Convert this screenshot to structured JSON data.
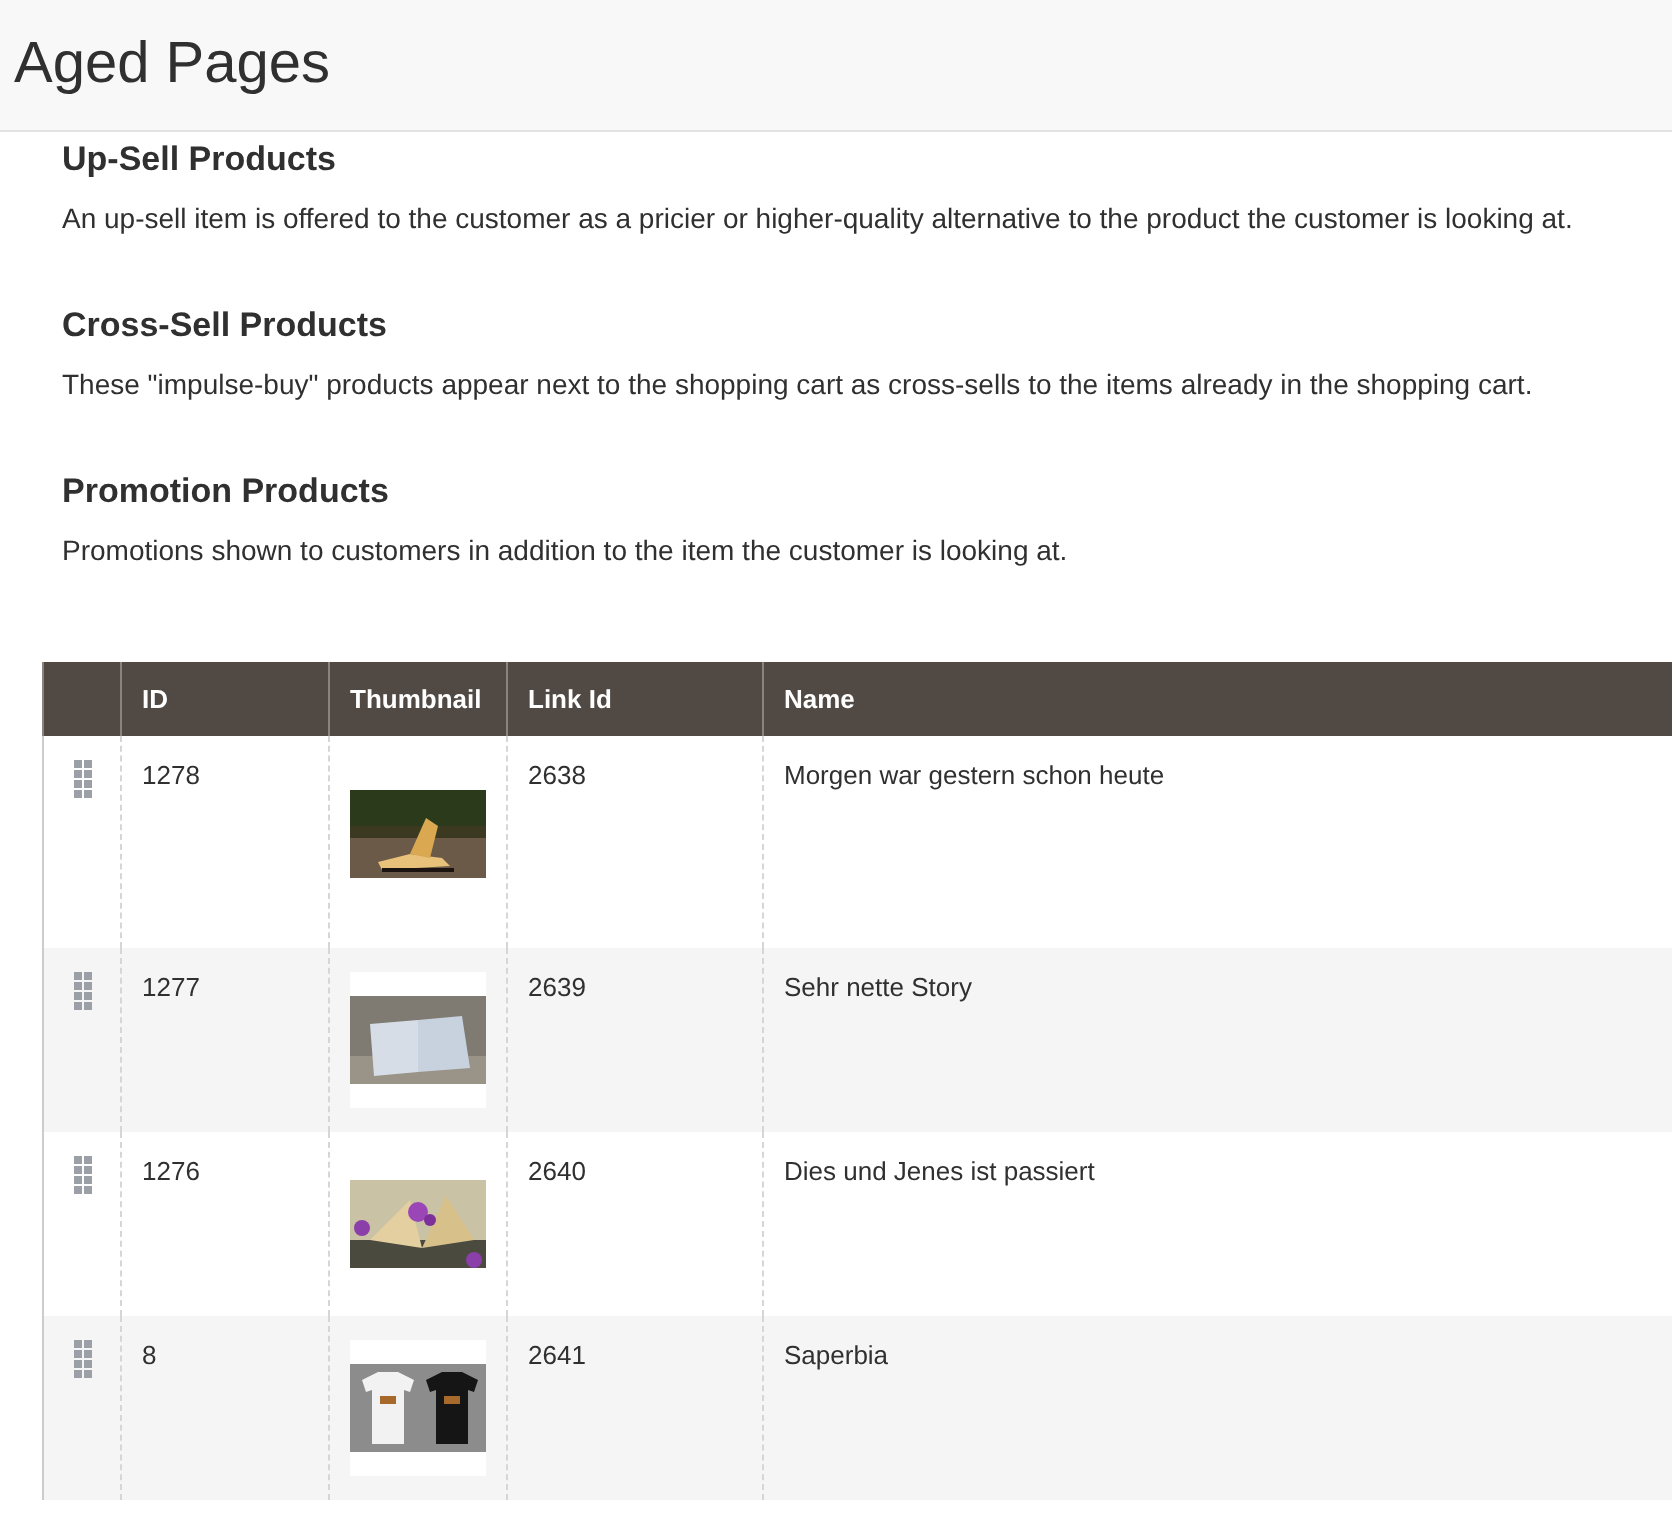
{
  "page_title": "Aged Pages",
  "sections": [
    {
      "heading": "Up-Sell Products",
      "description": "An up-sell item is offered to the customer as a pricier or higher-quality alternative to the product the customer is looking at."
    },
    {
      "heading": "Cross-Sell Products",
      "description": "These \"impulse-buy\" products appear next to the shopping cart as cross-sells to the items already in the shopping cart."
    },
    {
      "heading": "Promotion Products",
      "description": "Promotions shown to customers in addition to the item the customer is looking at."
    }
  ],
  "table": {
    "columns": [
      "ID",
      "Thumbnail",
      "Link Id",
      "Name"
    ],
    "rows": [
      {
        "id": "1278",
        "link_id": "2638",
        "name": "Morgen war gestern schon heute"
      },
      {
        "id": "1277",
        "link_id": "2639",
        "name": "Sehr nette Story"
      },
      {
        "id": "1276",
        "link_id": "2640",
        "name": "Dies und Jenes ist passiert"
      },
      {
        "id": "8",
        "link_id": "2641",
        "name": "Saperbia"
      }
    ]
  }
}
